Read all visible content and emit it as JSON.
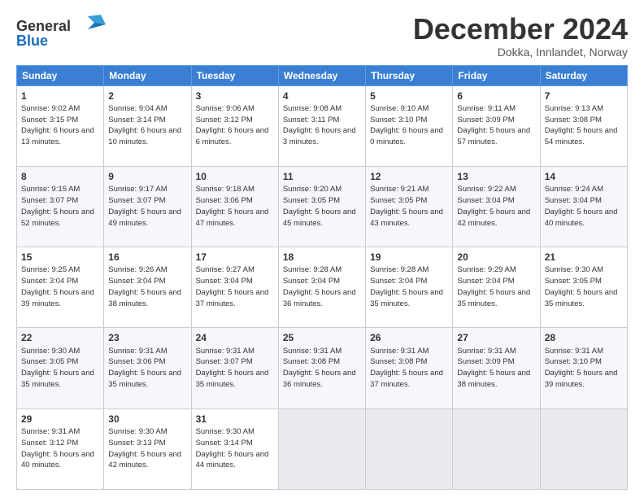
{
  "header": {
    "logo_line1": "General",
    "logo_line2": "Blue",
    "month_title": "December 2024",
    "location": "Dokka, Innlandet, Norway"
  },
  "calendar": {
    "weekdays": [
      "Sunday",
      "Monday",
      "Tuesday",
      "Wednesday",
      "Thursday",
      "Friday",
      "Saturday"
    ],
    "weeks": [
      [
        {
          "day": "1",
          "sunrise": "9:02 AM",
          "sunset": "3:15 PM",
          "daylight": "6 hours and 13 minutes."
        },
        {
          "day": "2",
          "sunrise": "9:04 AM",
          "sunset": "3:14 PM",
          "daylight": "6 hours and 10 minutes."
        },
        {
          "day": "3",
          "sunrise": "9:06 AM",
          "sunset": "3:12 PM",
          "daylight": "6 hours and 6 minutes."
        },
        {
          "day": "4",
          "sunrise": "9:08 AM",
          "sunset": "3:11 PM",
          "daylight": "6 hours and 3 minutes."
        },
        {
          "day": "5",
          "sunrise": "9:10 AM",
          "sunset": "3:10 PM",
          "daylight": "6 hours and 0 minutes."
        },
        {
          "day": "6",
          "sunrise": "9:11 AM",
          "sunset": "3:09 PM",
          "daylight": "5 hours and 57 minutes."
        },
        {
          "day": "7",
          "sunrise": "9:13 AM",
          "sunset": "3:08 PM",
          "daylight": "5 hours and 54 minutes."
        }
      ],
      [
        {
          "day": "8",
          "sunrise": "9:15 AM",
          "sunset": "3:07 PM",
          "daylight": "5 hours and 52 minutes."
        },
        {
          "day": "9",
          "sunrise": "9:17 AM",
          "sunset": "3:07 PM",
          "daylight": "5 hours and 49 minutes."
        },
        {
          "day": "10",
          "sunrise": "9:18 AM",
          "sunset": "3:06 PM",
          "daylight": "5 hours and 47 minutes."
        },
        {
          "day": "11",
          "sunrise": "9:20 AM",
          "sunset": "3:05 PM",
          "daylight": "5 hours and 45 minutes."
        },
        {
          "day": "12",
          "sunrise": "9:21 AM",
          "sunset": "3:05 PM",
          "daylight": "5 hours and 43 minutes."
        },
        {
          "day": "13",
          "sunrise": "9:22 AM",
          "sunset": "3:04 PM",
          "daylight": "5 hours and 42 minutes."
        },
        {
          "day": "14",
          "sunrise": "9:24 AM",
          "sunset": "3:04 PM",
          "daylight": "5 hours and 40 minutes."
        }
      ],
      [
        {
          "day": "15",
          "sunrise": "9:25 AM",
          "sunset": "3:04 PM",
          "daylight": "5 hours and 39 minutes."
        },
        {
          "day": "16",
          "sunrise": "9:26 AM",
          "sunset": "3:04 PM",
          "daylight": "5 hours and 38 minutes."
        },
        {
          "day": "17",
          "sunrise": "9:27 AM",
          "sunset": "3:04 PM",
          "daylight": "5 hours and 37 minutes."
        },
        {
          "day": "18",
          "sunrise": "9:28 AM",
          "sunset": "3:04 PM",
          "daylight": "5 hours and 36 minutes."
        },
        {
          "day": "19",
          "sunrise": "9:28 AM",
          "sunset": "3:04 PM",
          "daylight": "5 hours and 35 minutes."
        },
        {
          "day": "20",
          "sunrise": "9:29 AM",
          "sunset": "3:04 PM",
          "daylight": "5 hours and 35 minutes."
        },
        {
          "day": "21",
          "sunrise": "9:30 AM",
          "sunset": "3:05 PM",
          "daylight": "5 hours and 35 minutes."
        }
      ],
      [
        {
          "day": "22",
          "sunrise": "9:30 AM",
          "sunset": "3:05 PM",
          "daylight": "5 hours and 35 minutes."
        },
        {
          "day": "23",
          "sunrise": "9:31 AM",
          "sunset": "3:06 PM",
          "daylight": "5 hours and 35 minutes."
        },
        {
          "day": "24",
          "sunrise": "9:31 AM",
          "sunset": "3:07 PM",
          "daylight": "5 hours and 35 minutes."
        },
        {
          "day": "25",
          "sunrise": "9:31 AM",
          "sunset": "3:08 PM",
          "daylight": "5 hours and 36 minutes."
        },
        {
          "day": "26",
          "sunrise": "9:31 AM",
          "sunset": "3:08 PM",
          "daylight": "5 hours and 37 minutes."
        },
        {
          "day": "27",
          "sunrise": "9:31 AM",
          "sunset": "3:09 PM",
          "daylight": "5 hours and 38 minutes."
        },
        {
          "day": "28",
          "sunrise": "9:31 AM",
          "sunset": "3:10 PM",
          "daylight": "5 hours and 39 minutes."
        }
      ],
      [
        {
          "day": "29",
          "sunrise": "9:31 AM",
          "sunset": "3:12 PM",
          "daylight": "5 hours and 40 minutes."
        },
        {
          "day": "30",
          "sunrise": "9:30 AM",
          "sunset": "3:13 PM",
          "daylight": "5 hours and 42 minutes."
        },
        {
          "day": "31",
          "sunrise": "9:30 AM",
          "sunset": "3:14 PM",
          "daylight": "5 hours and 44 minutes."
        },
        null,
        null,
        null,
        null
      ]
    ]
  }
}
